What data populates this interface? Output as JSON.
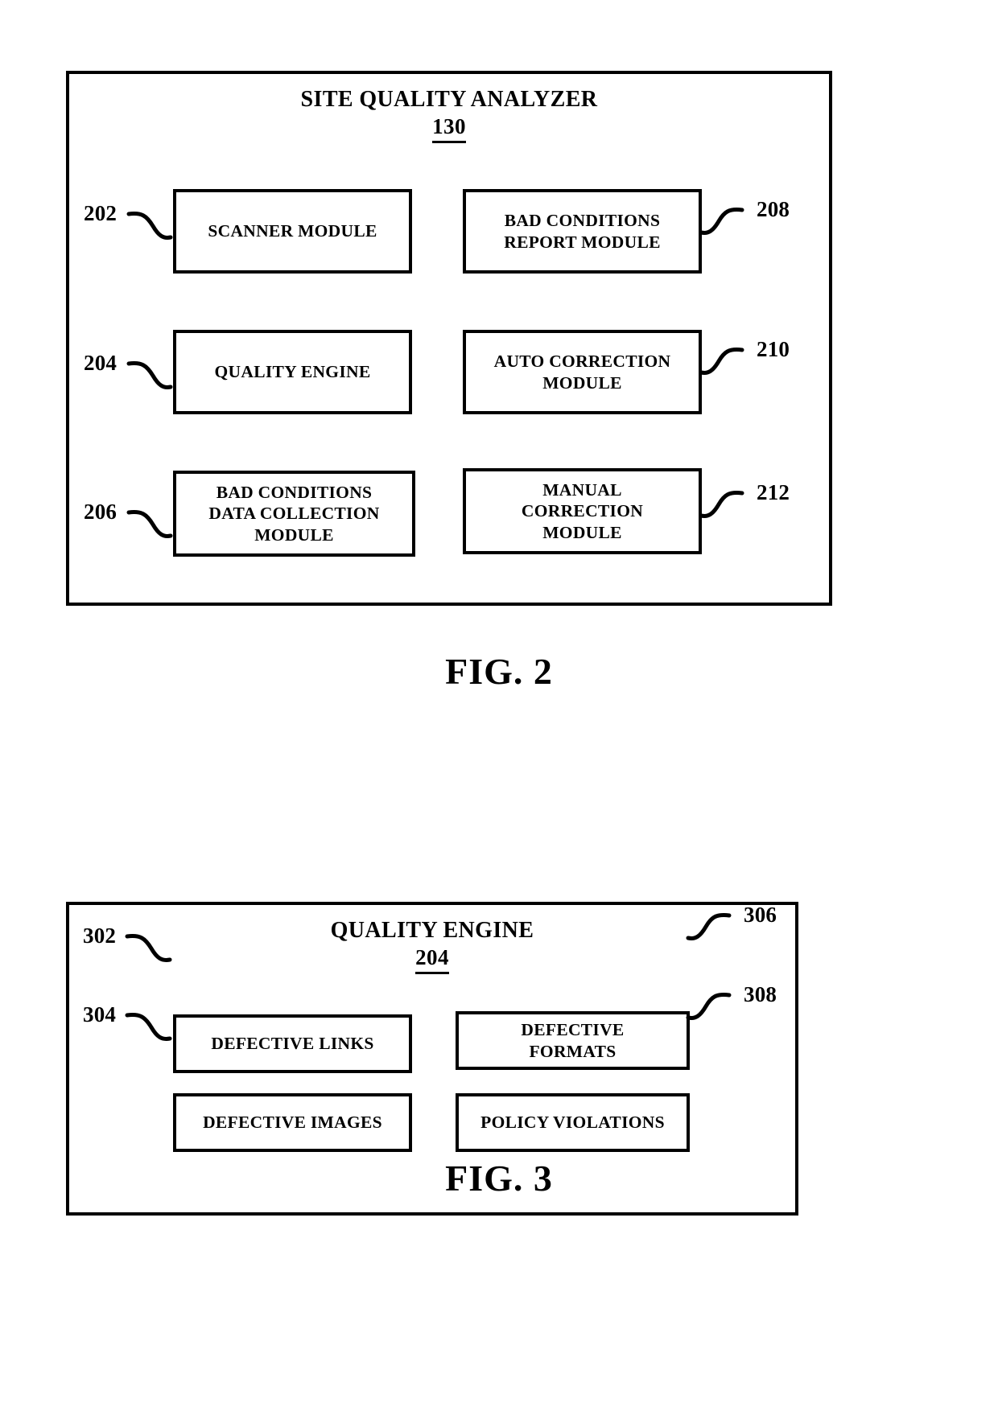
{
  "document": {
    "type": "patent-figure-sheet",
    "background_color": "#ffffff",
    "ink_color": "#000000"
  },
  "figure2": {
    "caption": "FIG. 2",
    "panel_title": "SITE QUALITY ANALYZER",
    "panel_ref": "130",
    "modules": [
      {
        "ref": "202",
        "ref_side": "left",
        "label": "SCANNER MODULE"
      },
      {
        "ref": "208",
        "ref_side": "right",
        "label": "BAD CONDITIONS\nREPORT MODULE"
      },
      {
        "ref": "204",
        "ref_side": "left",
        "label": "QUALITY ENGINE"
      },
      {
        "ref": "210",
        "ref_side": "right",
        "label": "AUTO CORRECTION\nMODULE"
      },
      {
        "ref": "206",
        "ref_side": "left",
        "label": "BAD CONDITIONS\nDATA COLLECTION\nMODULE"
      },
      {
        "ref": "212",
        "ref_side": "right",
        "label": "MANUAL\nCORRECTION\nMODULE"
      }
    ]
  },
  "figure3": {
    "caption": "FIG. 3",
    "panel_title": "QUALITY ENGINE",
    "panel_ref": "204",
    "modules": [
      {
        "ref": "302",
        "ref_side": "left",
        "label": "DEFECTIVE LINKS"
      },
      {
        "ref": "306",
        "ref_side": "right",
        "label": "DEFECTIVE\nFORMATS"
      },
      {
        "ref": "304",
        "ref_side": "left",
        "label": "DEFECTIVE IMAGES"
      },
      {
        "ref": "308",
        "ref_side": "right",
        "label": "POLICY VIOLATIONS"
      }
    ]
  }
}
